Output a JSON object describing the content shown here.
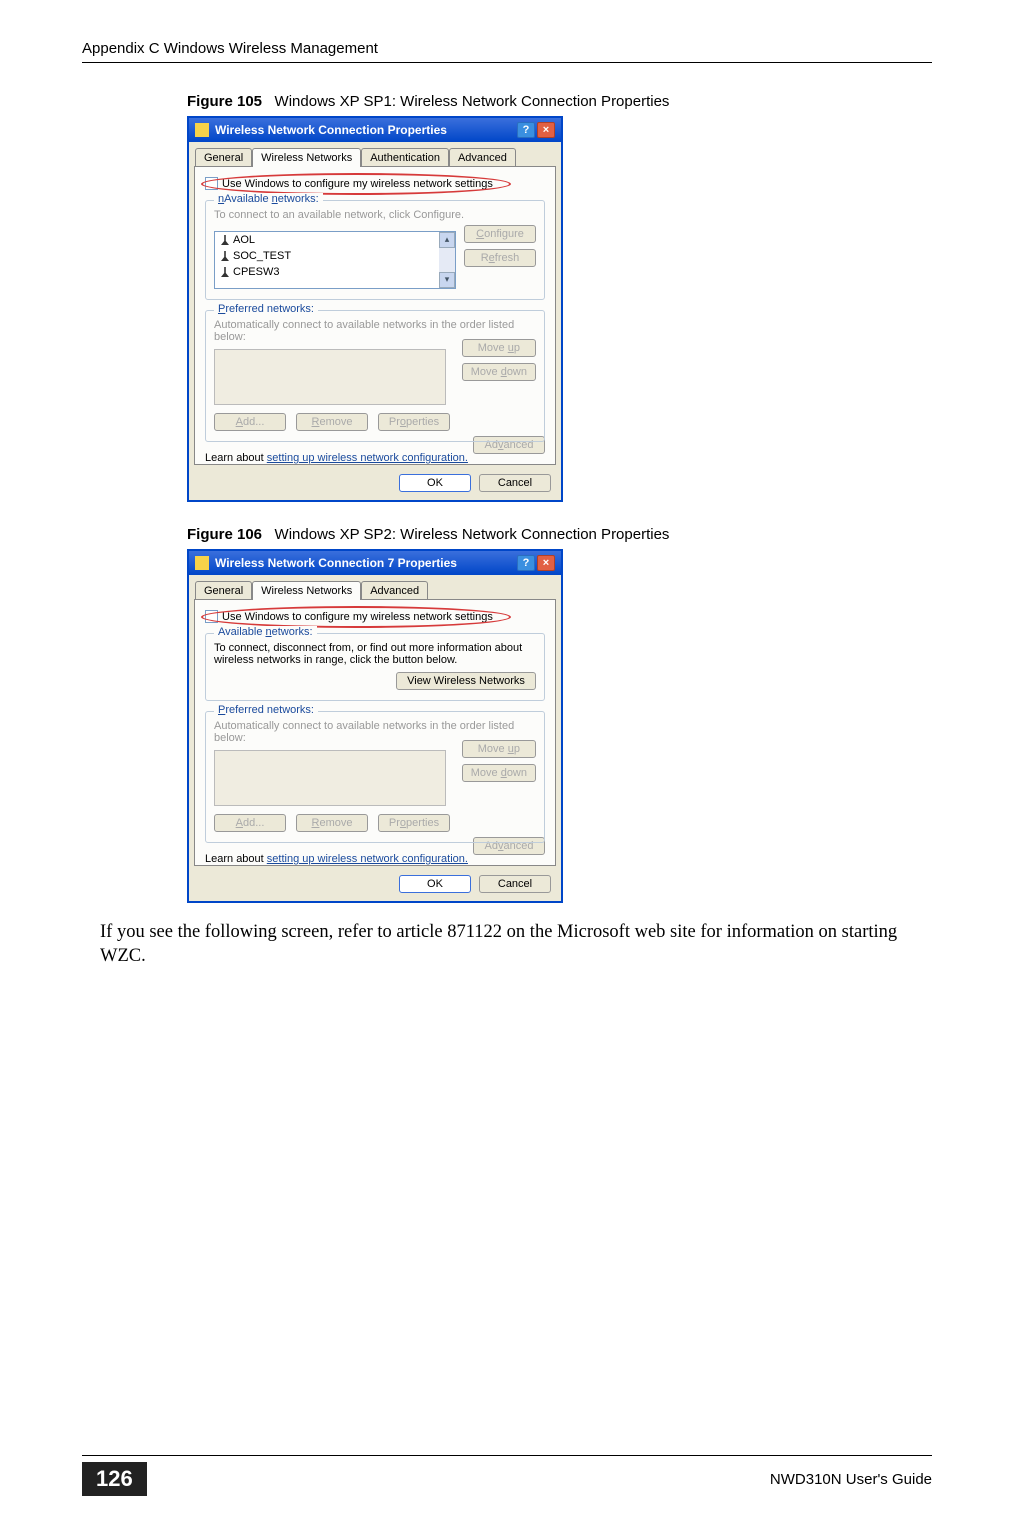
{
  "header": {
    "appendix": "Appendix C Windows Wireless Management"
  },
  "fig105": {
    "caption_num": "Figure 105",
    "caption_txt": "Windows XP SP1: Wireless Network Connection Properties",
    "title": "Wireless Network Connection Properties",
    "tabs": {
      "general": "General",
      "wireless": "Wireless Networks",
      "auth": "Authentication",
      "adv": "Advanced"
    },
    "checkbox": "Use Windows to configure my wireless network settings",
    "avail": {
      "label": "Available networks:",
      "hint": "To connect to an available network, click Configure.",
      "items": [
        "AOL",
        "SOC_TEST",
        "CPESW3"
      ],
      "configure": "Configure",
      "refresh": "Refresh"
    },
    "pref": {
      "label": "Preferred networks:",
      "hint": "Automatically connect to available networks in the order listed below:",
      "moveup": "Move up",
      "movedown": "Move down",
      "add": "Add...",
      "remove": "Remove",
      "props": "Properties"
    },
    "learn": {
      "pre": "Learn about ",
      "link": "setting up wireless network configuration."
    },
    "advanced": "Advanced",
    "ok": "OK",
    "cancel": "Cancel"
  },
  "fig106": {
    "caption_num": "Figure 106",
    "caption_txt": "Windows XP SP2: Wireless Network Connection Properties",
    "title": "Wireless Network Connection 7 Properties",
    "tabs": {
      "general": "General",
      "wireless": "Wireless Networks",
      "adv": "Advanced"
    },
    "checkbox": "Use Windows to configure my wireless network settings",
    "avail": {
      "label": "Available networks:",
      "hint": "To connect, disconnect from, or find out more information about wireless networks in range, click the button below.",
      "view": "View Wireless Networks"
    },
    "pref": {
      "label": "Preferred networks:",
      "hint": "Automatically connect to available networks in the order listed below:",
      "moveup": "Move up",
      "movedown": "Move down",
      "add": "Add...",
      "remove": "Remove",
      "props": "Properties"
    },
    "learn": {
      "pre": "Learn about ",
      "link": "setting up wireless network configuration."
    },
    "advanced": "Advanced",
    "ok": "OK",
    "cancel": "Cancel"
  },
  "bodytext": "If you see the following screen, refer to article 871122 on the Microsoft web site for information on starting WZC.",
  "footer": {
    "page": "126",
    "guide": "NWD310N User's Guide"
  }
}
